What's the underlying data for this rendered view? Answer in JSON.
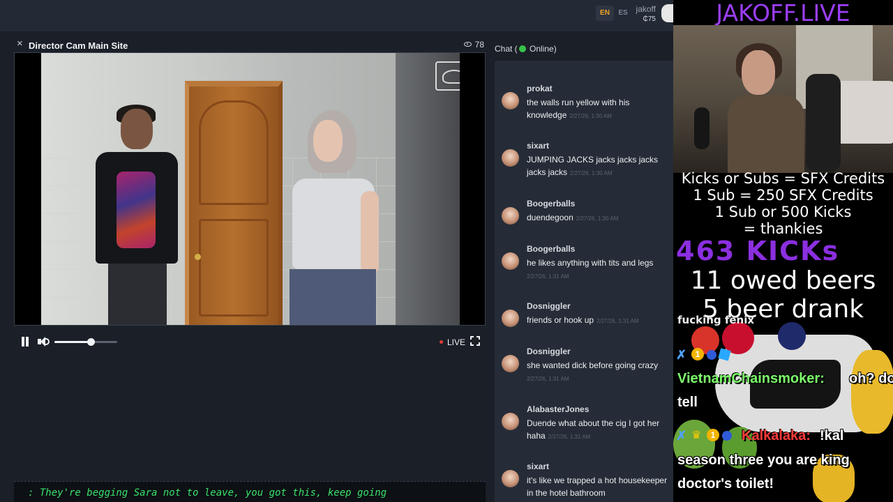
{
  "topbar": {
    "lang_en": "EN",
    "lang_es": "ES",
    "username": "jakoff",
    "credits": "₵75"
  },
  "player": {
    "title": "Director Cam Main Site",
    "close": "×",
    "viewers": "78",
    "live_label": "LIVE",
    "volume_level": 0.58,
    "ticker": ": They're begging Sara not to leave, you got this, keep going"
  },
  "chat": {
    "header_prefix": "Chat (",
    "header_status": "Online)",
    "messages": [
      {
        "user": "prokat",
        "text": "the walls run yellow with his knowledge",
        "time": "2/27/26, 1:30 AM"
      },
      {
        "user": "sixart",
        "text": "JUMPING JACKS jacks jacks jacks jacks jacks",
        "time": "2/27/26, 1:30 AM"
      },
      {
        "user": "Boogerballs",
        "text": "duendegoon",
        "time": "2/27/26, 1:30 AM"
      },
      {
        "user": "Boogerballs",
        "text": "he likes anything with tits and legs",
        "time": "2/27/26, 1:31 AM"
      },
      {
        "user": "Dosniggler",
        "text": "friends or hook up",
        "time": "2/27/26, 1:31 AM"
      },
      {
        "user": "Dosniggler",
        "text": "she wanted dick before going crazy",
        "time": "2/27/26, 1:31 AM"
      },
      {
        "user": "AlabasterJones",
        "text": "Duende what about the cig I got her haha",
        "time": "2/27/26, 1:31 AM"
      },
      {
        "user": "sixart",
        "text": "it's like we trapped a hot housekeeper in the hotel bathroom",
        "time": ""
      }
    ]
  },
  "stream": {
    "brand": "JAKOFF.LIVE",
    "rules": [
      "Kicks or Subs = SFX Credits",
      "1 Sub = 250 SFX Credits",
      "1 Sub or 500 Kicks",
      "= thankies"
    ],
    "kicks": "463 KICKs",
    "owed_beers": "11 owed beers",
    "beer_drank": "5 beer drank",
    "cut_text": "fucking fenix",
    "chat1_name": "VietnamChainsmoker:",
    "chat1_text_a": "oh? do",
    "chat1_text_b": "tell",
    "chat2_name": "Kalkalaka:",
    "chat2_text_a": "!kal",
    "chat2_text_b": "season three you are king",
    "chat2_text_c": "doctor's toilet!",
    "colors": {
      "brand": "#9b3ef5",
      "chat1_name": "#7dff6b",
      "chat2_name": "#ff3b3b",
      "ticker": "#39e06b"
    }
  }
}
